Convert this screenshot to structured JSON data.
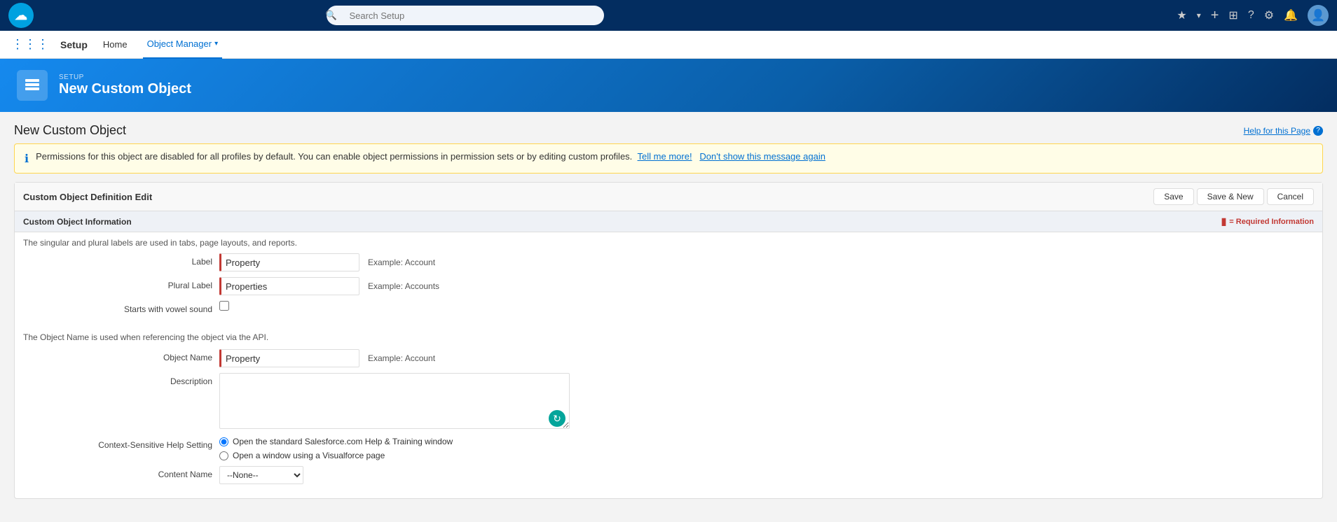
{
  "topNav": {
    "logoText": "☁",
    "searchPlaceholder": "Search Setup",
    "icons": {
      "star": "★",
      "dropdown": "▾",
      "plus": "+",
      "building": "🏢",
      "question": "?",
      "gear": "⚙",
      "bell": "🔔"
    }
  },
  "secondNav": {
    "appName": "Setup",
    "items": [
      {
        "label": "Home",
        "active": false
      },
      {
        "label": "Object Manager",
        "active": true
      }
    ]
  },
  "pageHeader": {
    "setupLabel": "SETUP",
    "pageTitle": "New Custom Object"
  },
  "mainCard": {
    "title": "New Custom Object",
    "helpLink": "Help for this Page",
    "infoBanner": {
      "text": "Permissions for this object are disabled for all profiles by default. You can enable object permissions in permission sets or by editing custom profiles.",
      "tellMeMore": "Tell me more!",
      "dontShow": "Don't show this message again"
    },
    "defEdit": {
      "title": "Custom Object Definition Edit",
      "buttons": {
        "save": "Save",
        "saveNew": "Save & New",
        "cancel": "Cancel"
      }
    },
    "section": {
      "title": "Custom Object Information",
      "requiredLabel": "= Required Information",
      "description": "The singular and plural labels are used in tabs, page layouts, and reports.",
      "apiNote": "The Object Name is used when referencing the object via the API."
    },
    "form": {
      "labelField": {
        "label": "Label",
        "value": "Property",
        "example": "Example:  Account",
        "required": true
      },
      "pluralLabelField": {
        "label": "Plural Label",
        "value": "Properties",
        "example": "Example:  Accounts",
        "required": true
      },
      "vowelField": {
        "label": "Starts with vowel sound"
      },
      "objectNameField": {
        "label": "Object Name",
        "value": "Property",
        "example": "Example:  Account",
        "required": true
      },
      "descriptionField": {
        "label": "Description",
        "value": ""
      },
      "contextHelpLabel": "Context-Sensitive Help Setting",
      "helpOptions": [
        {
          "id": "help1",
          "label": "Open the standard Salesforce.com Help & Training window",
          "checked": true
        },
        {
          "id": "help2",
          "label": "Open a window using a Visualforce page",
          "checked": false
        }
      ],
      "contentNameLabel": "Content Name",
      "contentNameOptions": [
        "--None--"
      ]
    }
  }
}
